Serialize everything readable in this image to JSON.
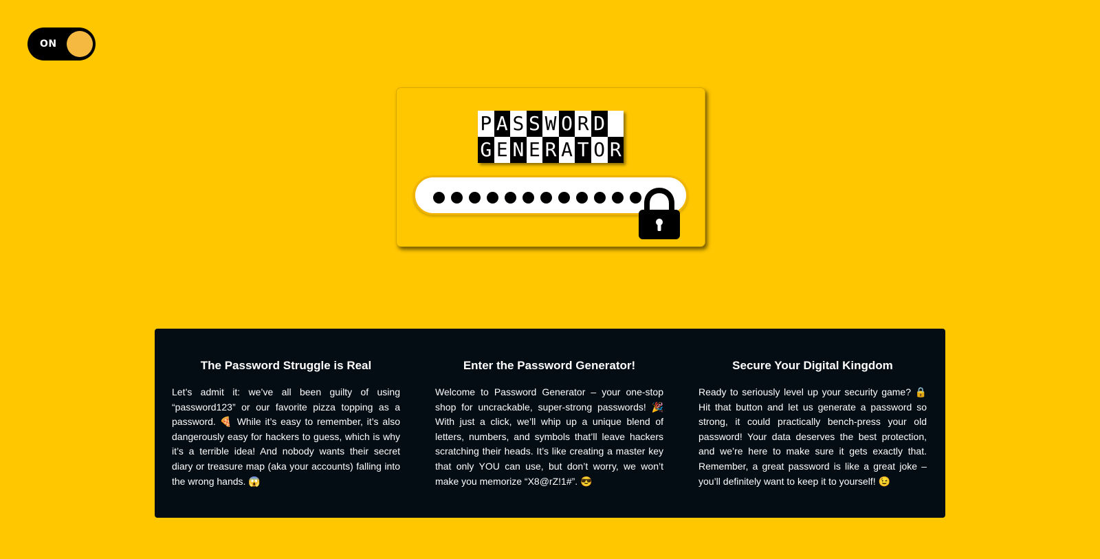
{
  "toggle": {
    "label": "ON",
    "state": "on"
  },
  "logo": {
    "line1": "PASSWORD",
    "line2": "GENERATOR"
  },
  "password_field": {
    "masked_value": "●●●●●●●●●●●●",
    "dot_count": 12
  },
  "icons": {
    "lock": "lock-icon"
  },
  "info": {
    "columns": [
      {
        "title": "The Password Struggle is Real",
        "text": "Let’s admit it: we’ve all been guilty of using “password123” or our favorite pizza topping as a password. 🍕 While it’s easy to remember, it’s also dangerously easy for hackers to guess, which is why it’s a terrible idea! And nobody wants their secret diary or treasure map (aka your accounts) falling into the wrong hands. 😱"
      },
      {
        "title": "Enter the Password Generator!",
        "text": "Welcome to Password Generator – your one-stop shop for uncrackable, super-strong passwords! 🎉 With just a click, we’ll whip up a unique blend of letters, numbers, and symbols that’ll leave hackers scratching their heads. It’s like creating a master key that only YOU can use, but don’t worry, we won’t make you memorize “X8@rZ!1#”. 😎"
      },
      {
        "title": "Secure Your Digital Kingdom",
        "text": "Ready to seriously level up your security game? 🔒 Hit that button and let us generate a password so strong, it could practically bench-press your old password! Your data deserves the best protection, and we’re here to make sure it gets exactly that. Remember, a great password is like a great joke – you’ll definitely want to keep it to yourself! 😉"
      }
    ]
  },
  "colors": {
    "background": "#ffc700",
    "panel": "#040c14",
    "toggle_knob": "#f5b942",
    "text_on_dark": "#ffffff"
  }
}
